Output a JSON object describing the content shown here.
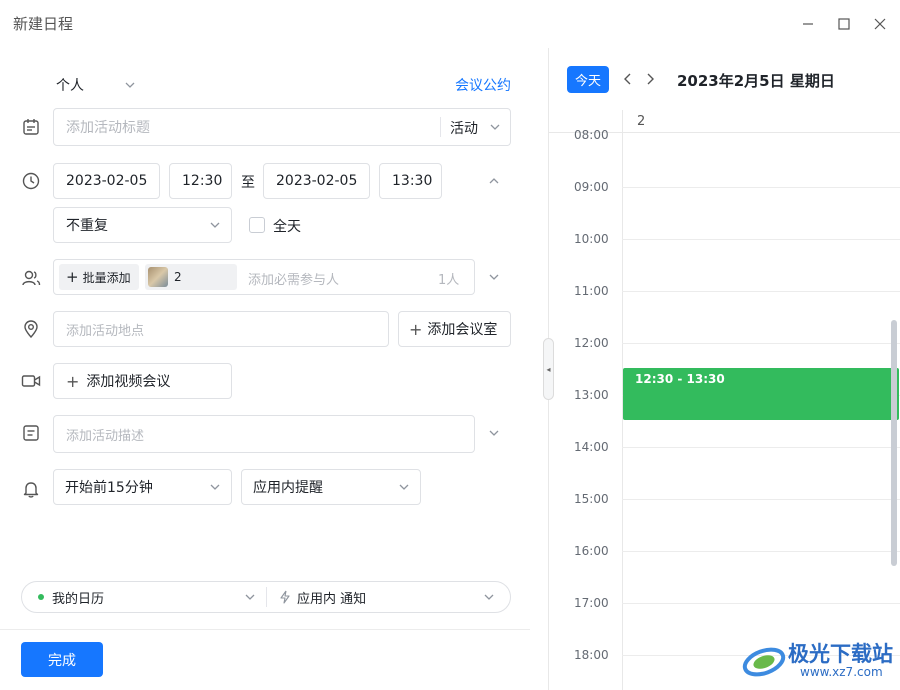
{
  "window": {
    "title": "新建日程"
  },
  "form": {
    "calendar_type": "个人",
    "meeting_policy_link": "会议公约",
    "title_placeholder": "添加活动标题",
    "event_type": "活动",
    "start_date": "2023-02-05",
    "start_time": "12:30",
    "to_label": "至",
    "end_date": "2023-02-05",
    "end_time": "13:30",
    "repeat": "不重复",
    "all_day_label": "全天",
    "batch_add_label": "批量添加",
    "attendee_count_chip": "2",
    "attendee_placeholder": "添加必需参与人",
    "attendee_total": "1人",
    "location_placeholder": "添加活动地点",
    "add_room_label": "添加会议室",
    "add_video_label": "添加视频会议",
    "description_placeholder": "添加活动描述",
    "reminder_time": "开始前15分钟",
    "reminder_method": "应用内提醒",
    "my_calendar": "我的日历",
    "notify_label": "应用内 通知",
    "done_label": "完成"
  },
  "calendar": {
    "today_label": "今天",
    "date_title": "2023年2月5日 星期日",
    "day_number": "2",
    "hours": [
      "08:00",
      "09:00",
      "10:00",
      "11:00",
      "12:00",
      "13:00",
      "14:00",
      "15:00",
      "16:00",
      "17:00",
      "18:00"
    ],
    "event_time": "12:30 - 13:30",
    "event_color": "#33bb5d",
    "accent_color": "#1677ff"
  },
  "watermark": {
    "text_cn": "极光下载站",
    "text_url": "www.xz7.com"
  }
}
